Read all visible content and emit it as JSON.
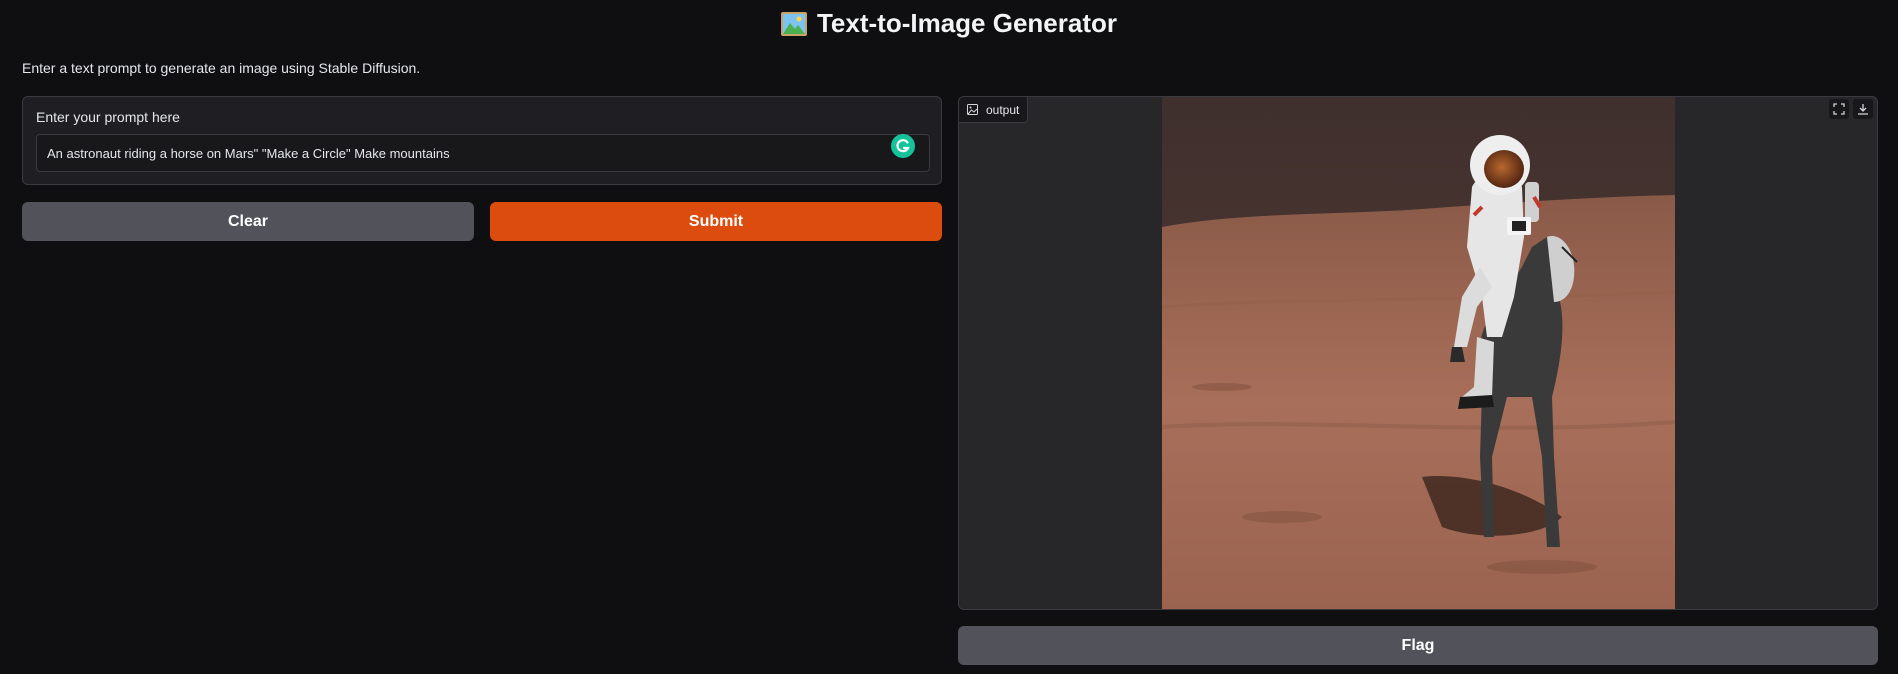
{
  "header": {
    "title": "Text-to-Image Generator",
    "title_icon": "framed-picture-icon"
  },
  "description": "Enter a text prompt to generate an image using Stable Diffusion.",
  "prompt": {
    "label": "Enter your prompt here",
    "value": "An astronaut riding a horse on Mars\" \"Make a Circle\" Make mountains"
  },
  "buttons": {
    "clear": "Clear",
    "submit": "Submit",
    "flag": "Flag"
  },
  "output": {
    "label": "output",
    "label_icon": "image-icon",
    "actions": [
      "fullscreen-icon",
      "download-icon"
    ],
    "image_subject": "astronaut riding a horse on Mars"
  },
  "colors": {
    "background": "#0f0f11",
    "accent": "#dd4c0f",
    "secondary_button": "#52525b",
    "panel": "#27272a"
  }
}
